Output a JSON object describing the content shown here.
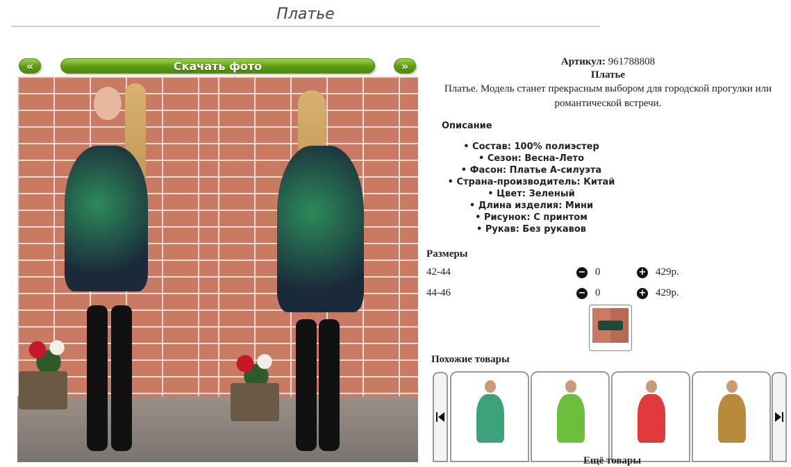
{
  "page": {
    "title": "Платье"
  },
  "gallery": {
    "prev_label": "«",
    "download_label": "Скачать фото",
    "next_label": "»"
  },
  "product": {
    "article_label": "Артикул:",
    "article_value": "961788808",
    "name": "Платье",
    "short_description": "Платье. Модель станет прекрасным выбором для городской прогулки или романтической встречи.",
    "description_title": "Описание",
    "specs": [
      "Состав: 100% полиэстер",
      "Сезон: Весна-Лето",
      "Фасон: Платье А-силуэта",
      "Страна-производитель: Китай",
      "Цвет: Зеленый",
      "Длина изделия: Мини",
      "Рисунок: С принтом",
      "Рукав: Без рукавов"
    ]
  },
  "sizes": {
    "title": "Размеры",
    "minus_icon": "minus-circle-icon",
    "plus_icon": "plus-circle-icon",
    "rows": [
      {
        "name": "42-44",
        "qty": "0",
        "price": "429р."
      },
      {
        "name": "44-46",
        "qty": "0",
        "price": "429р."
      }
    ]
  },
  "similar": {
    "title": "Похожие товары",
    "prev_icon": "skip-back-icon",
    "next_icon": "skip-forward-icon",
    "items": [
      {
        "color": "#3ba27a"
      },
      {
        "color": "#6bbf3a"
      },
      {
        "color": "#e23a3a"
      },
      {
        "color": "#b98a3c"
      }
    ],
    "more_label": "Ещё товары"
  },
  "colors": {
    "accent_green": "#5f9a12",
    "brick": "#c97a62"
  }
}
